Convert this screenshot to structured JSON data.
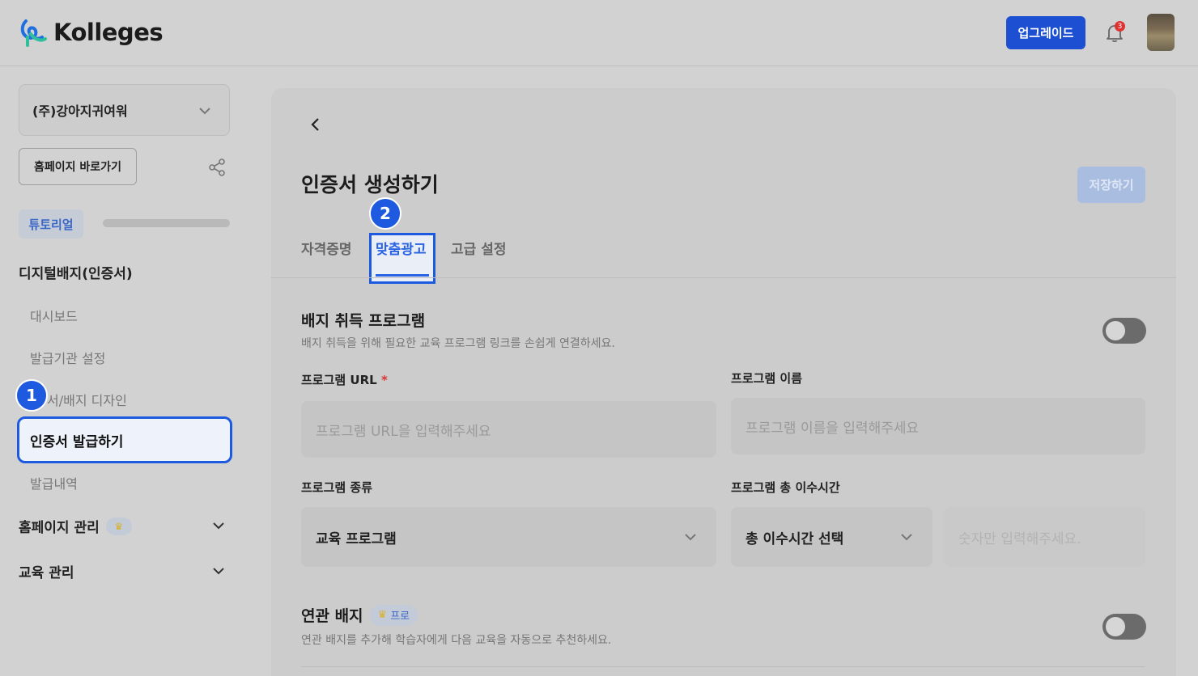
{
  "header": {
    "brand": "Kolleges",
    "upgrade_label": "업그레이드",
    "notification_count": "3"
  },
  "sidebar": {
    "org_name": "(주)강아지귀여워",
    "home_button": "홈페이지 바로가기",
    "tutorial_label": "튜토리얼",
    "section_title": "디지털배지(인증서)",
    "items": [
      {
        "label": "대시보드"
      },
      {
        "label": "발급기관 설정"
      },
      {
        "label": "서/배지 디자인"
      },
      {
        "label": "인증서 발급하기"
      },
      {
        "label": "발급내역"
      }
    ],
    "groups": [
      {
        "label": "홈페이지 관리",
        "crown": "♛"
      },
      {
        "label": "교육 관리"
      }
    ],
    "step_markers": [
      "1",
      "2"
    ]
  },
  "main": {
    "title": "인증서 생성하기",
    "save_label": "저장하기",
    "tabs": [
      {
        "label": "자격증명"
      },
      {
        "label": "맞춤광고"
      },
      {
        "label": "고급 설정"
      }
    ],
    "badge_program": {
      "title": "배지 취득 프로그램",
      "description": "배지 취득을 위해 필요한 교육 프로그램 링크를 손쉽게 연결하세요.",
      "enabled": false
    },
    "fields": {
      "url_label": "프로그램 URL",
      "url_required": "*",
      "url_placeholder": "프로그램 URL을 입력해주세요",
      "name_label": "프로그램 이름",
      "name_placeholder": "프로그램 이름을 입력해주세요",
      "type_label": "프로그램 종류",
      "type_value": "교육 프로그램",
      "hours_label": "프로그램 총 이수시간",
      "hours_value": "총 이수시간 선택",
      "hours_placeholder": "숫자만 입력해주세요."
    },
    "related_badge": {
      "title": "연관 배지",
      "pro_label": "프로",
      "pro_icon": "♛",
      "description": "연관 배지를 추가해 학습자에게 다음 교육을 자동으로 추천하세요.",
      "enabled": false
    }
  }
}
